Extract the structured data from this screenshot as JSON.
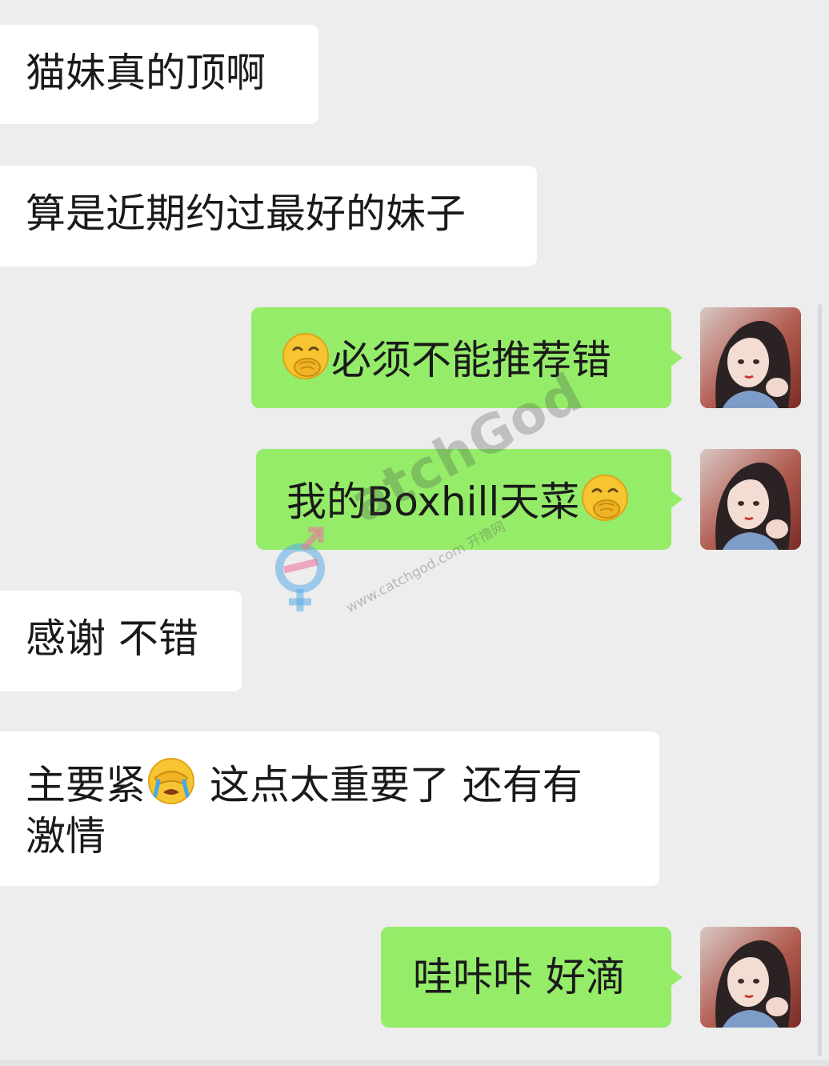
{
  "messages": [
    {
      "side": "in",
      "text": "猫妹真的顶啊"
    },
    {
      "side": "in",
      "text": "算是近期约过最好的妹子"
    },
    {
      "side": "out",
      "emoji": "hand-over-mouth-emoji",
      "text": "必须不能推荐错"
    },
    {
      "side": "out",
      "text": "我的Boxhill天菜",
      "emoji": "hand-over-mouth-emoji"
    },
    {
      "side": "in",
      "text": "感谢 不错"
    },
    {
      "side": "in",
      "text_before": "主要紧",
      "emoji": "face-palm-tears-emoji",
      "text_after": " 这点太重要了 还有有",
      "line2": "激情"
    },
    {
      "side": "out",
      "text": "哇咔咔 好滴"
    }
  ],
  "watermark": {
    "logo": "atchGod",
    "url": "www.catchgod.com 开撸网"
  },
  "colors": {
    "background": "#ededed",
    "incoming_bubble": "#ffffff",
    "outgoing_bubble": "#95ec69"
  }
}
